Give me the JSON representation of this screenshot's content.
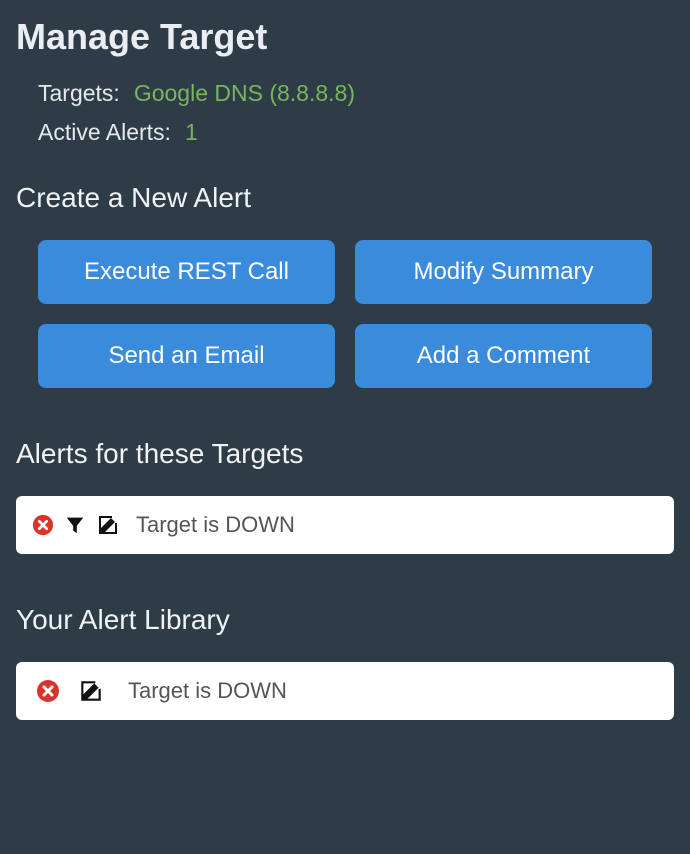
{
  "page": {
    "title": "Manage Target"
  },
  "meta": {
    "targets_label": "Targets:",
    "targets_value": "Google DNS (8.8.8.8)",
    "active_alerts_label": "Active Alerts:",
    "active_alerts_value": "1"
  },
  "create": {
    "title": "Create a New Alert",
    "buttons": {
      "execute_rest": "Execute REST Call",
      "modify_summary": "Modify Summary",
      "send_email": "Send an Email",
      "add_comment": "Add a Comment"
    }
  },
  "alerts_section": {
    "title": "Alerts for these Targets",
    "items": [
      {
        "label": "Target is DOWN"
      }
    ]
  },
  "library_section": {
    "title": "Your Alert Library",
    "items": [
      {
        "label": "Target is DOWN"
      }
    ]
  }
}
